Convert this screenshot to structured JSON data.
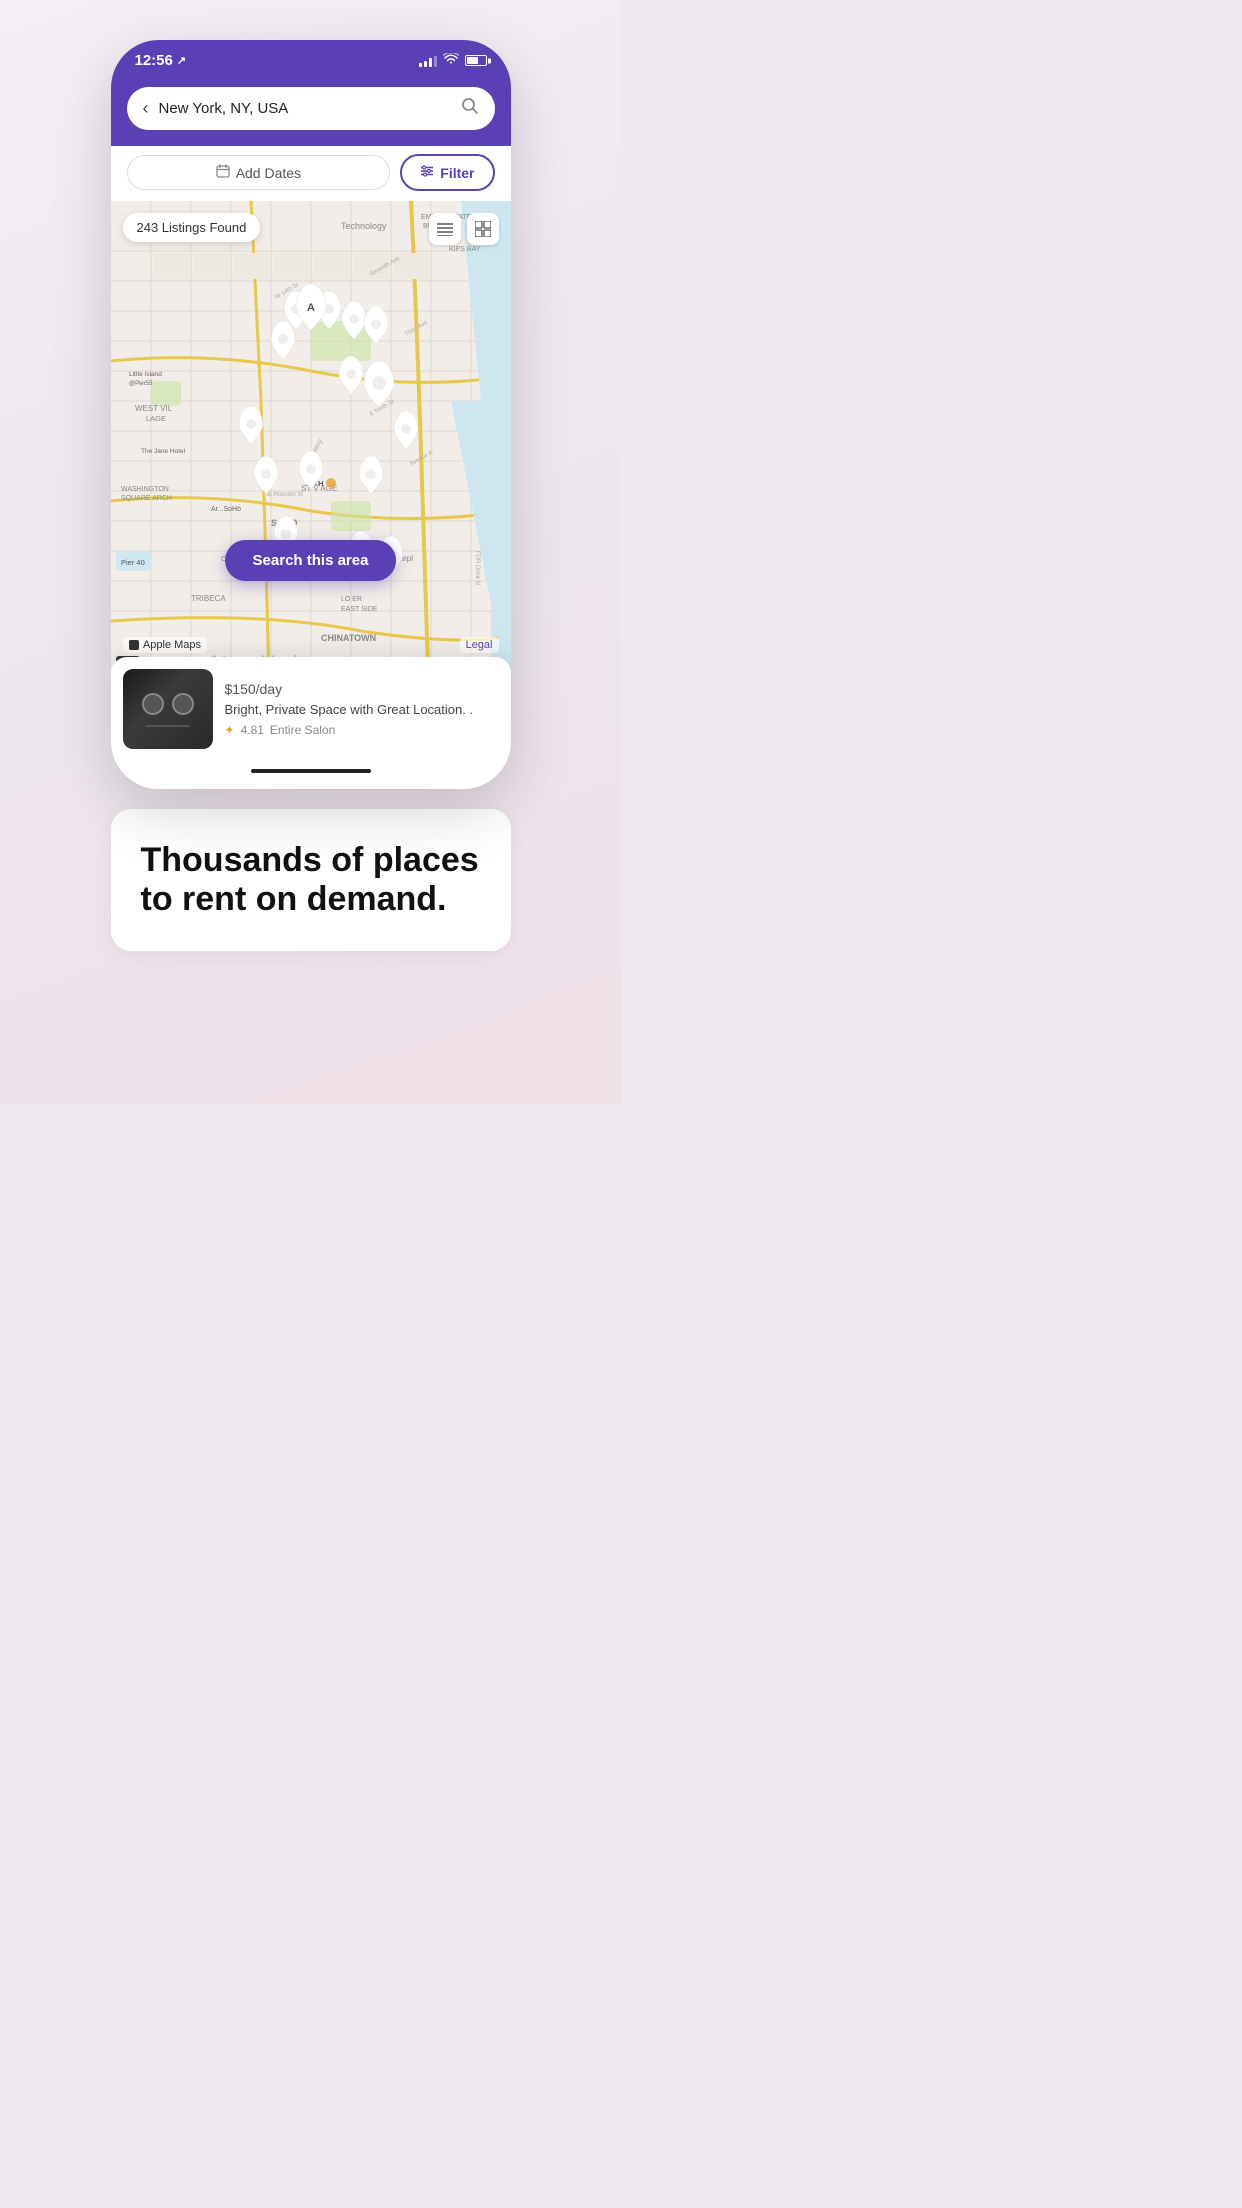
{
  "status_bar": {
    "time": "12:56",
    "location_arrow": "✈",
    "signal_bars": [
      3,
      5,
      7,
      9
    ],
    "wifi": "wifi",
    "battery_percent": 55
  },
  "search": {
    "back_label": "‹",
    "location_text": "New York, NY, USA",
    "search_icon": "search"
  },
  "filter_row": {
    "add_dates_label": "Add Dates",
    "calendar_icon": "calendar",
    "filter_label": "Filter",
    "filter_icon": "sliders"
  },
  "map": {
    "listings_count": "243 Listings Found",
    "list_icon": "list",
    "grid_icon": "grid",
    "search_area_button": "Search this area",
    "apple_maps_label": "Apple Maps",
    "legal_label": "Legal"
  },
  "listing_card": {
    "price": "$150",
    "price_unit": "/day",
    "title": "Bright, Private Space with Great Location. .",
    "rating": "4.81",
    "type": "Entire Salon"
  },
  "bottom_section": {
    "headline_line1": "Thousands of places",
    "headline_line2": "to rent on demand."
  }
}
